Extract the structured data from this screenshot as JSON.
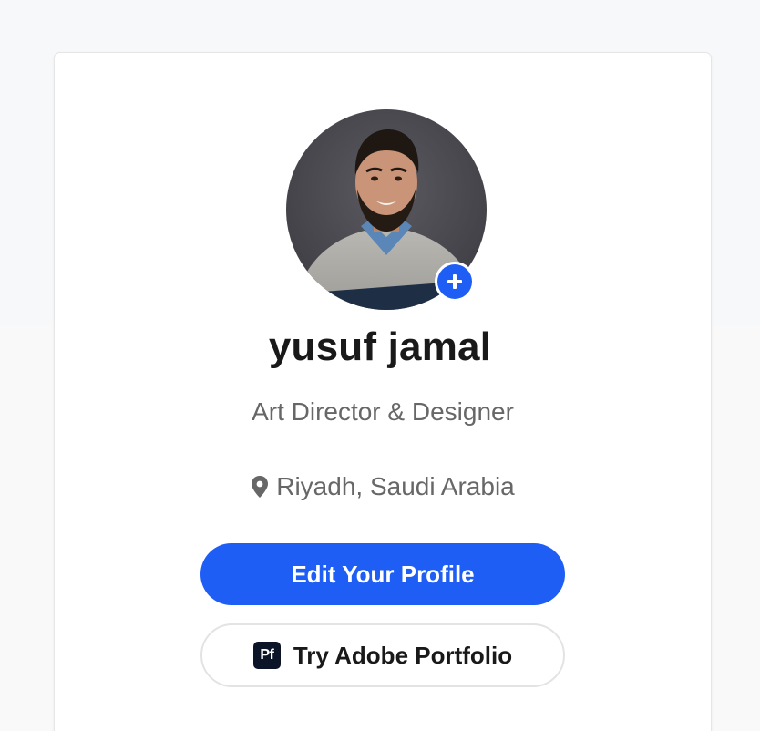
{
  "profile": {
    "name": "yusuf jamal",
    "occupation": "Art Director & Designer",
    "location": "Riyadh, Saudi Arabia"
  },
  "actions": {
    "edit_profile_label": "Edit Your Profile",
    "portfolio_label": "Try Adobe Portfolio",
    "portfolio_logo_text": "Pf"
  },
  "icons": {
    "avatar_add": "plus-icon",
    "location": "map-pin-icon",
    "portfolio": "adobe-portfolio-logo-icon"
  },
  "colors": {
    "accent": "#1f5ef5",
    "name_text": "#191919",
    "secondary_text": "#676767",
    "portfolio_logo_bg": "#0c1527"
  }
}
